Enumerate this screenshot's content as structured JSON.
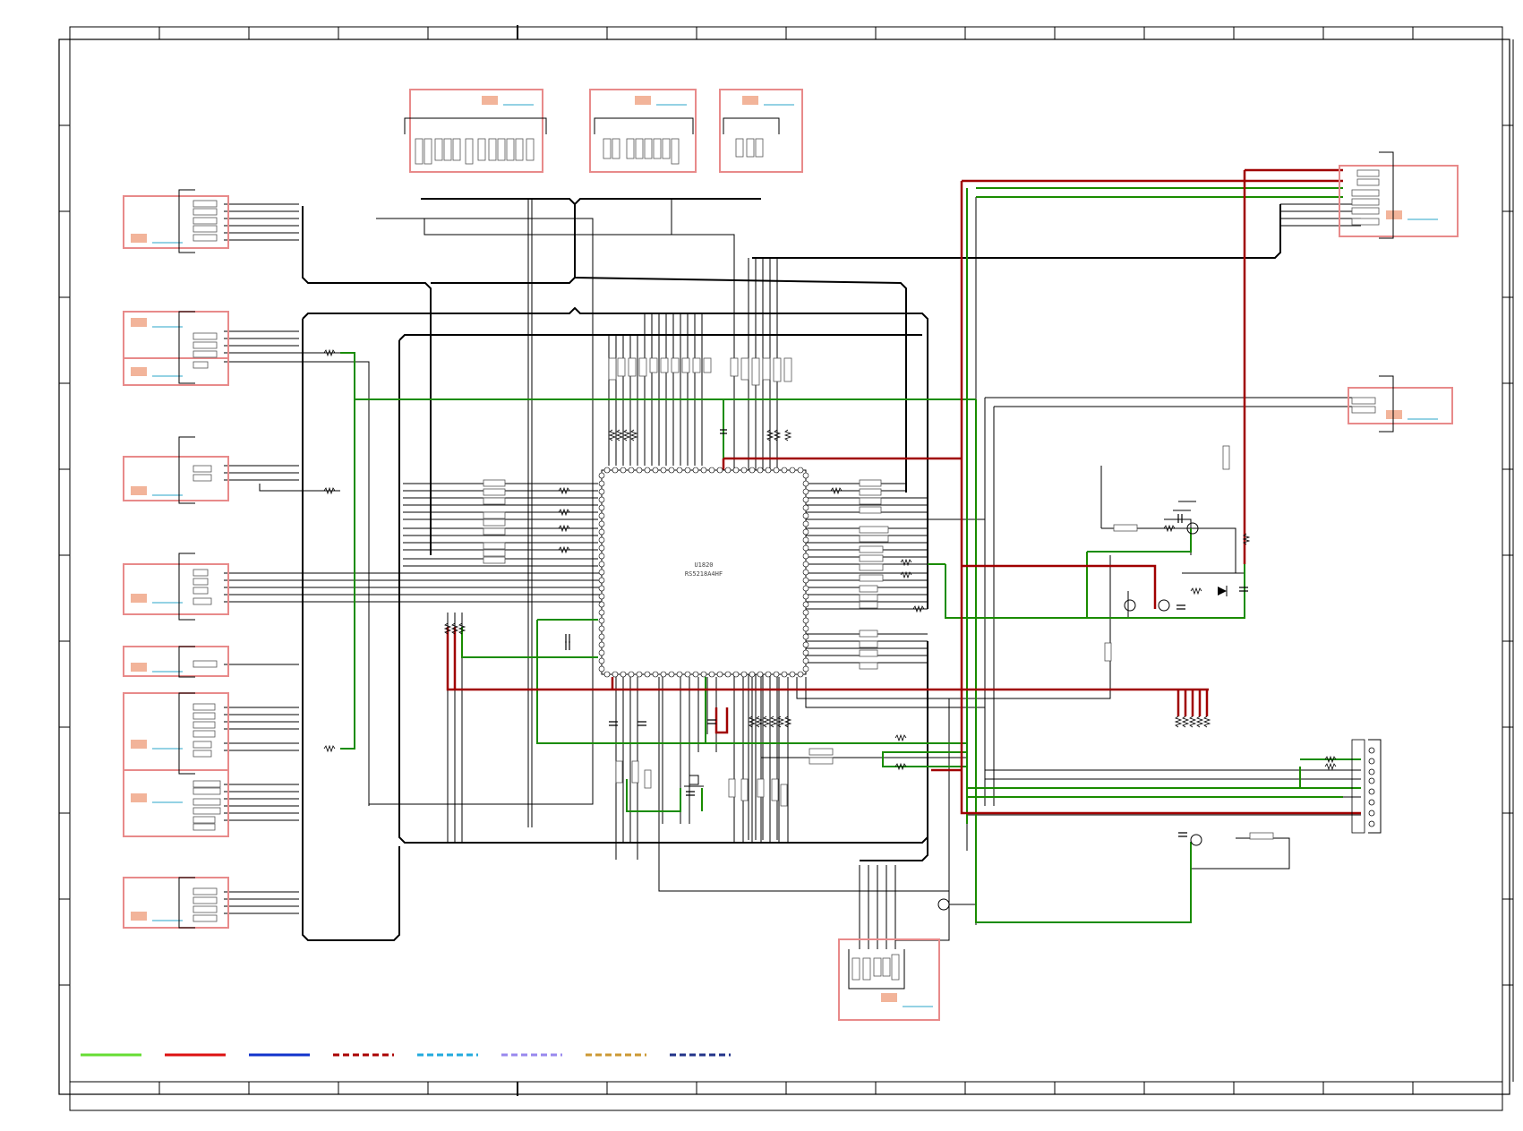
{
  "title": "",
  "ic": {
    "ref": "U1820",
    "part": "RS5218A4HF"
  },
  "colors": {
    "frame": "#000000",
    "wire": "#000000",
    "net_green": "#1a8c00",
    "net_red": "#a00000",
    "block_border": "#e88a8a",
    "block_tag": "#f2b49a",
    "block_line": "#2aa6c8",
    "legend": [
      "#66dd33",
      "#dd1111",
      "#1133cc",
      "#aa0000",
      "#22aadd",
      "#9988ee",
      "#cc9933",
      "#223388"
    ]
  },
  "legend": [
    {
      "color": "#66dd33",
      "style": "solid"
    },
    {
      "color": "#dd1111",
      "style": "solid"
    },
    {
      "color": "#1133cc",
      "style": "solid"
    },
    {
      "color": "#aa0000",
      "style": "dashed"
    },
    {
      "color": "#22aadd",
      "style": "dashed"
    },
    {
      "color": "#9988ee",
      "style": "dashed"
    },
    {
      "color": "#cc9933",
      "style": "dashed"
    },
    {
      "color": "#223388",
      "style": "dashed"
    }
  ]
}
